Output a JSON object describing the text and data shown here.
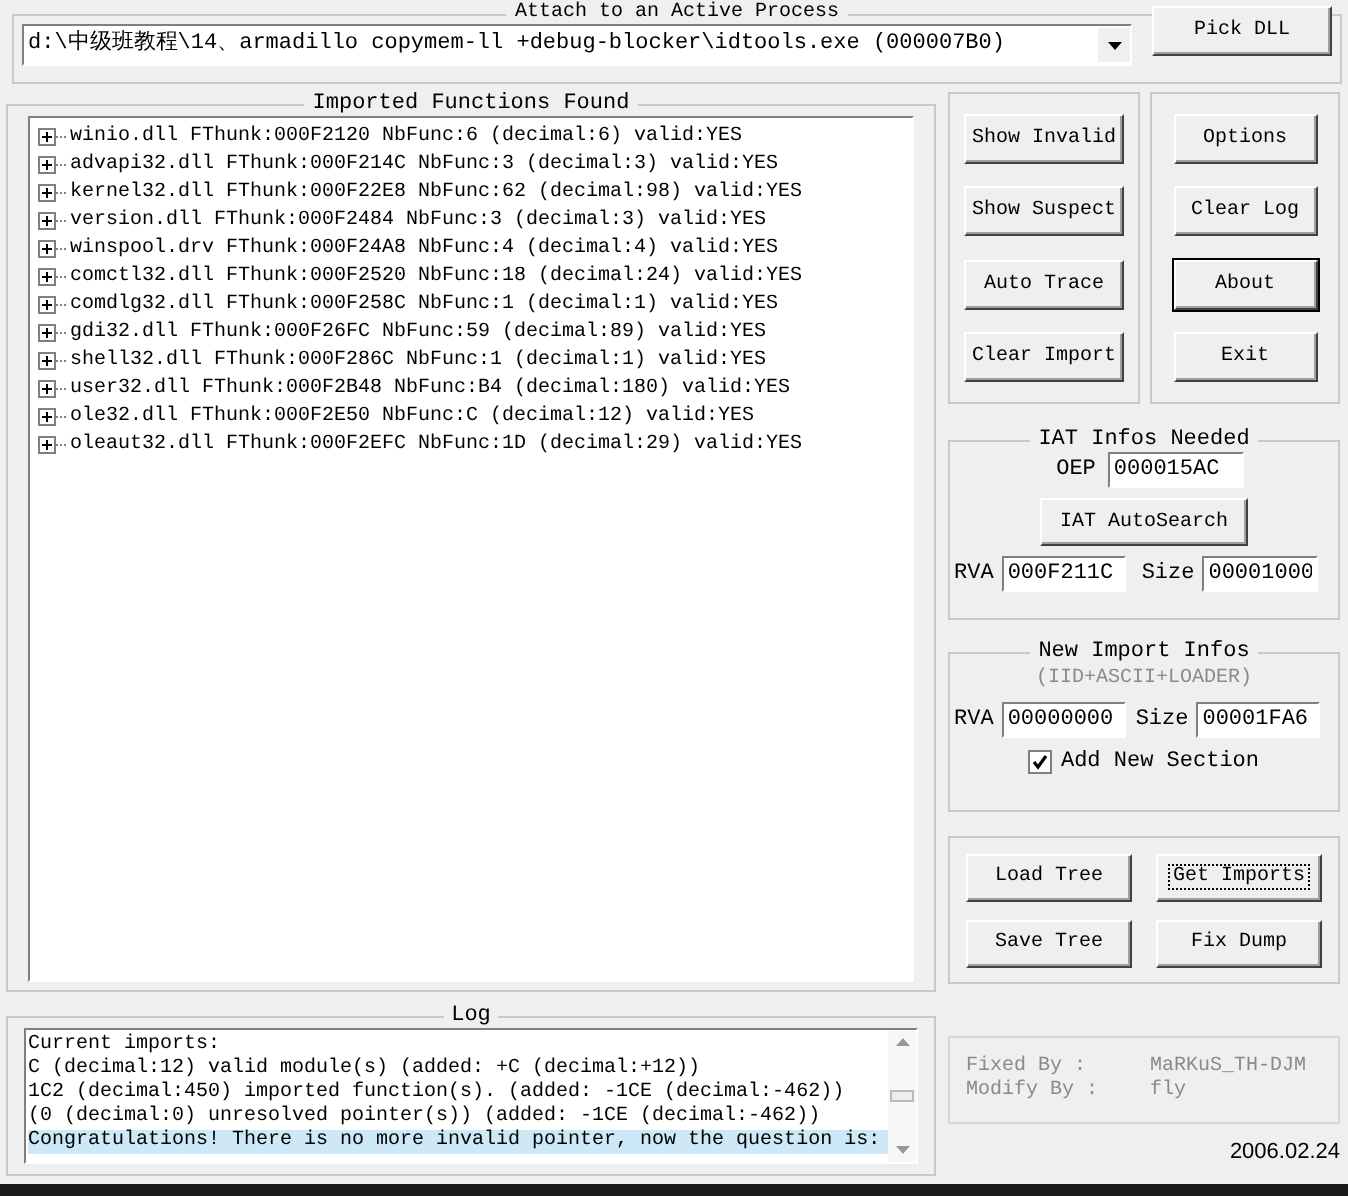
{
  "process_group": {
    "title": "Attach to an Active Process",
    "process_combo": {
      "value": "d:\\中级班教程\\14、armadillo copymem-ll +debug-blocker\\idtools.exe (000007B0)"
    },
    "pick_dll_button": "Pick DLL"
  },
  "imports_group": {
    "title": "Imported Functions Found",
    "modules": [
      {
        "text": "winio.dll FThunk:000F2120 NbFunc:6 (decimal:6) valid:YES",
        "expanded": false
      },
      {
        "text": "advapi32.dll FThunk:000F214C NbFunc:3 (decimal:3) valid:YES",
        "expanded": false
      },
      {
        "text": "kernel32.dll FThunk:000F22E8 NbFunc:62 (decimal:98) valid:YES",
        "expanded": false
      },
      {
        "text": "version.dll FThunk:000F2484 NbFunc:3 (decimal:3) valid:YES",
        "expanded": false
      },
      {
        "text": "winspool.drv FThunk:000F24A8 NbFunc:4 (decimal:4) valid:YES",
        "expanded": false
      },
      {
        "text": "comctl32.dll FThunk:000F2520 NbFunc:18 (decimal:24) valid:YES",
        "expanded": false
      },
      {
        "text": "comdlg32.dll FThunk:000F258C NbFunc:1 (decimal:1) valid:YES",
        "expanded": false
      },
      {
        "text": "gdi32.dll FThunk:000F26FC NbFunc:59 (decimal:89) valid:YES",
        "expanded": false
      },
      {
        "text": "shell32.dll FThunk:000F286C NbFunc:1 (decimal:1) valid:YES",
        "expanded": false
      },
      {
        "text": "user32.dll FThunk:000F2B48 NbFunc:B4 (decimal:180) valid:YES",
        "expanded": false
      },
      {
        "text": "ole32.dll FThunk:000F2E50 NbFunc:C (decimal:12) valid:YES",
        "expanded": false
      },
      {
        "text": "oleaut32.dll FThunk:000F2EFC NbFunc:1D (decimal:29) valid:YES",
        "expanded": false
      }
    ]
  },
  "buttons_left": [
    {
      "label": "Show Invalid",
      "default": false
    },
    {
      "label": "Show Suspect",
      "default": false
    },
    {
      "label": "Auto Trace",
      "default": false
    },
    {
      "label": "Clear Import",
      "default": false
    }
  ],
  "buttons_right": [
    {
      "label": "Options",
      "default": false
    },
    {
      "label": "Clear Log",
      "default": false
    },
    {
      "label": "About",
      "default": true
    },
    {
      "label": "Exit",
      "default": false
    }
  ],
  "iat_infos": {
    "title": "IAT Infos Needed",
    "oep_label": "OEP",
    "oep": "000015AC",
    "autosearch_button": "IAT AutoSearch",
    "rva_label": "RVA",
    "rva": "000F211C",
    "size_label": "Size",
    "size": "00001000"
  },
  "new_import_infos": {
    "title": "New Import Infos",
    "hint": "(IID+ASCII+LOADER)",
    "rva_label": "RVA",
    "rva": "00000000",
    "size_label": "Size",
    "size": "00001FA6",
    "add_new_section": {
      "label": "Add New Section",
      "checked": true
    }
  },
  "tree_buttons": [
    {
      "label": "Load Tree",
      "focused": false
    },
    {
      "label": "Get Imports",
      "focused": true
    },
    {
      "label": "Save Tree",
      "focused": false
    },
    {
      "label": "Fix Dump",
      "focused": false
    }
  ],
  "log": {
    "title": "Log",
    "lines": [
      {
        "text": "Current imports:",
        "selected": false
      },
      {
        "text": "C (decimal:12) valid module(s) (added: +C (decimal:+12))",
        "selected": false
      },
      {
        "text": "1C2 (decimal:450) imported function(s). (added: -1CE (decimal:-462))",
        "selected": false
      },
      {
        "text": "(0 (decimal:0) unresolved pointer(s)) (added: -1CE (decimal:-462))",
        "selected": false
      },
      {
        "text": "Congratulations! There is no more invalid pointer, now the question is:",
        "selected": true
      }
    ]
  },
  "credits": [
    {
      "label": "Fixed By :",
      "value": "MaRKuS_TH-DJM"
    },
    {
      "label": "Modify By :",
      "value": "fly"
    }
  ],
  "date": "2006.02.24"
}
